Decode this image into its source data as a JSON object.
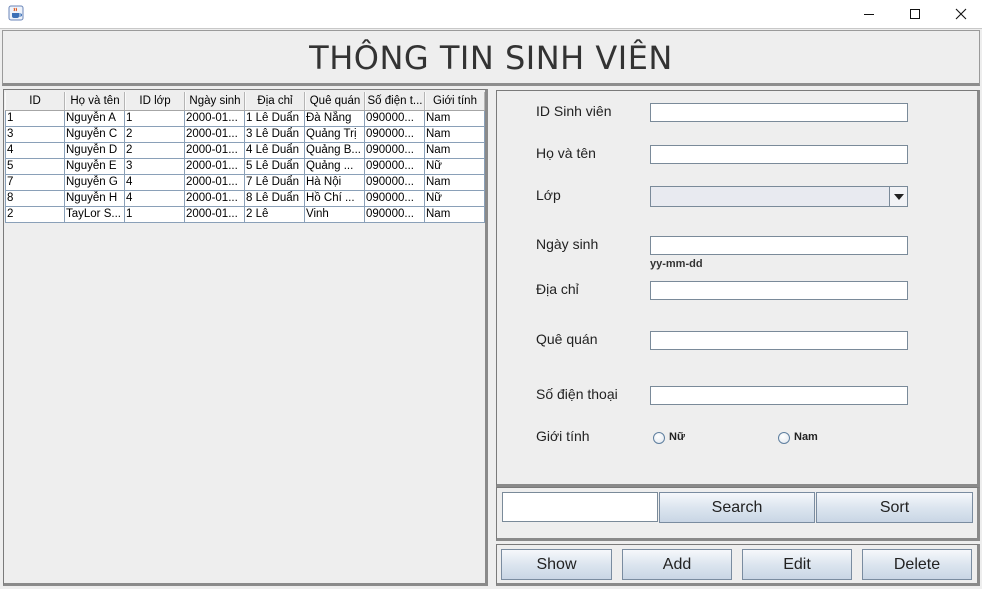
{
  "window": {
    "icon": "java-cup-icon",
    "controls": [
      "minimize-icon",
      "maximize-icon",
      "close-icon"
    ]
  },
  "header": {
    "title": "THÔNG TIN SINH VIÊN"
  },
  "table": {
    "columns": [
      "ID",
      "Họ và tên",
      "ID lớp",
      "Ngày sinh",
      "Địa chỉ",
      "Quê quán",
      "Số điện t...",
      "Giới tính"
    ],
    "rows": [
      [
        "1",
        "Nguyễn A",
        "1",
        "2000-01...",
        "1 Lê Duẩn",
        "Đà Nẵng",
        "090000...",
        "Nam"
      ],
      [
        "3",
        "Nguyễn C",
        "2",
        "2000-01...",
        "3 Lê Duẩn",
        "Quảng Trị",
        "090000...",
        "Nam"
      ],
      [
        "4",
        "Nguyễn D",
        "2",
        "2000-01...",
        "4 Lê Duẩn",
        "Quảng B...",
        "090000...",
        "Nam"
      ],
      [
        "5",
        "Nguyễn E",
        "3",
        "2000-01...",
        "5 Lê Duẩn",
        "Quảng ...",
        "090000...",
        "Nữ"
      ],
      [
        "7",
        "Nguyễn G",
        "4",
        "2000-01...",
        "7 Lê Duẩn",
        "Hà Nội",
        "090000...",
        "Nam"
      ],
      [
        "8",
        "Nguyễn H",
        "4",
        "2000-01...",
        "8 Lê Duẩn",
        "Hồ Chí ...",
        "090000...",
        "Nữ"
      ],
      [
        "2",
        "TayLor S...",
        "1",
        "2000-01...",
        "2 Lê",
        "Vinh",
        "090000...",
        "Nam"
      ]
    ]
  },
  "form": {
    "id_label": "ID Sinh viên",
    "id_value": "",
    "name_label": "Họ và tên",
    "name_value": "",
    "class_label": "Lớp",
    "class_selected": "",
    "dob_label": "Ngày sinh",
    "dob_value": "",
    "dob_hint": "yy-mm-dd",
    "address_label": "Địa chỉ",
    "address_value": "",
    "hometown_label": "Quê quán",
    "hometown_value": "",
    "phone_label": "Số điện thoại",
    "phone_value": "",
    "gender_label": "Giới tính",
    "gender_female": "Nữ",
    "gender_male": "Nam"
  },
  "search": {
    "value": "",
    "search_label": "Search",
    "sort_label": "Sort"
  },
  "actions": {
    "show": "Show",
    "add": "Add",
    "edit": "Edit",
    "delete": "Delete"
  }
}
